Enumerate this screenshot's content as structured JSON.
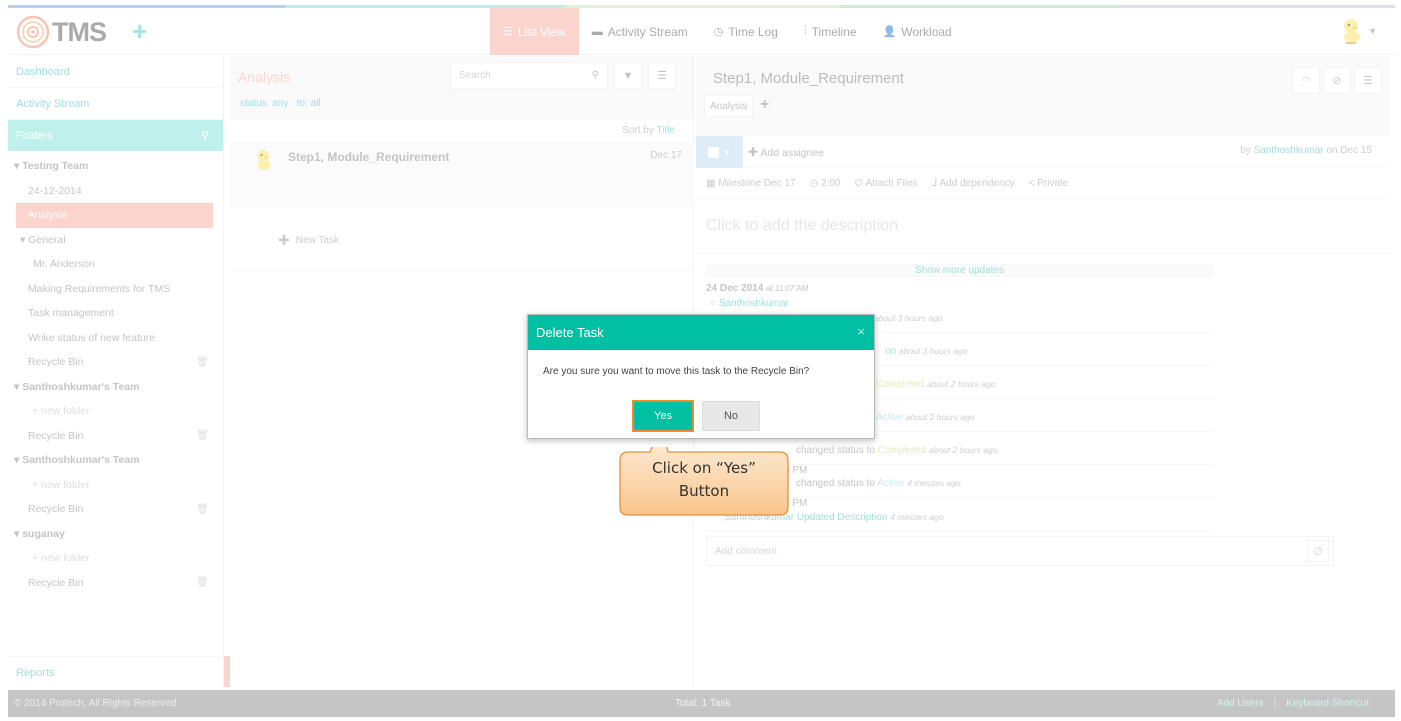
{
  "header": {
    "logo_text": "TMS",
    "nav": [
      {
        "label": "List View",
        "icon": "list-icon",
        "active": true
      },
      {
        "label": "Activity Stream",
        "icon": "comment-icon",
        "active": false
      },
      {
        "label": "Time Log",
        "icon": "clock-icon",
        "active": false
      },
      {
        "label": "Timeline",
        "icon": "sliders-icon",
        "active": false
      },
      {
        "label": "Workload",
        "icon": "user-icon",
        "active": false
      }
    ]
  },
  "sidebar": {
    "dashboard": "Dashboard",
    "activity_stream": "Activity Stream",
    "folders": "Folders",
    "items": [
      {
        "label": "Testing Team",
        "type": "team"
      },
      {
        "label": "24-12-2014",
        "type": "sub"
      },
      {
        "label": "Analysis",
        "type": "active"
      },
      {
        "label": "General",
        "type": "subteam"
      },
      {
        "label": "Mr. Anderson",
        "type": "sub2"
      },
      {
        "label": "Making Requirements for TMS",
        "type": "sub"
      },
      {
        "label": "Task management",
        "type": "sub"
      },
      {
        "label": "Wrike status of new feature",
        "type": "sub"
      },
      {
        "label": "Recycle Bin",
        "type": "bin"
      },
      {
        "label": "Santhoshkumar's Team",
        "type": "team"
      },
      {
        "label": "+ new folder",
        "type": "new"
      },
      {
        "label": "Recycle Bin",
        "type": "bin"
      },
      {
        "label": "Santhoshkumar's Team",
        "type": "team"
      },
      {
        "label": "+ new folder",
        "type": "new"
      },
      {
        "label": "Recycle Bin",
        "type": "bin"
      },
      {
        "label": "suganay",
        "type": "team"
      },
      {
        "label": "+ new folder",
        "type": "new"
      },
      {
        "label": "Recycle Bin",
        "type": "bin"
      }
    ],
    "reports": "Reports"
  },
  "list": {
    "title": "Analysis",
    "filter_status": "status: any",
    "filter_to": "to: all",
    "search_placeholder": "Search",
    "sort_prefix": "Sort by",
    "sort_field": "Title",
    "task_name": "Step1, Module_Requirement",
    "task_date": "Dec 17",
    "new_task": "New Task"
  },
  "detail": {
    "title": "Step1, Module_Requirement",
    "tag": "Analysis",
    "add_assignee": "Add assignee",
    "by_prefix": "by",
    "by_user": "Santhoshkumar",
    "by_date": "on Dec 15",
    "milestone": "Milestone Dec 17",
    "time": "2:00",
    "attach": "Attach Files",
    "dependency": "Add dependency",
    "privacy": "Private",
    "description_placeholder": "Click to add the description",
    "show_more": "Show more updates",
    "update_date": "24 Dec 2014",
    "update_time": "at 11:07 AM",
    "update_user": "Santhoshkumar",
    "updates": [
      {
        "pre": "",
        "hl": "",
        "time": "about 3 hours ago",
        "cls": "l"
      },
      {
        "pre": "",
        "hl": "on",
        "time": "about 3 hours ago",
        "cls": "l"
      },
      {
        "pre": "",
        "hl": "Completed",
        "time": "about 2 hours ago",
        "cls": "g"
      },
      {
        "pre": "",
        "hl": "Active",
        "time": "about 2 hours ago",
        "cls": "b"
      },
      {
        "pre": "changed status to",
        "hl": "Completed",
        "time": "about 2 hours ago",
        "cls": "g"
      },
      {
        "pre": "changed status to",
        "hl": "Active",
        "time": "4 minutes ago",
        "cls": "b"
      },
      {
        "pre": "Santhoshkumar",
        "hl": "Updated Description",
        "time": "4 minutes ago",
        "cls": "l"
      }
    ],
    "time_stamps": [
      "6 PM",
      "7 PM"
    ],
    "comment_placeholder": "Add comment"
  },
  "footer": {
    "copyright": "© 2014 Protech, All Rights Reserved",
    "total": "Total: 1 Task",
    "add_users": "Add Users",
    "separator": "|",
    "shortcut": "Keyboard Shortcut"
  },
  "modal": {
    "title": "Delete Task",
    "close": "×",
    "message": "Are you sure you want to move this task to the Recycle Bin?",
    "yes": "Yes",
    "no": "No"
  },
  "callout": {
    "line1": "Click on “Yes”",
    "line2": "Button"
  },
  "colors": {
    "accent": "#00bfa3",
    "active_nav": "#f7a99b",
    "link": "#3fbfb5",
    "callout": "#fbd3a6"
  }
}
